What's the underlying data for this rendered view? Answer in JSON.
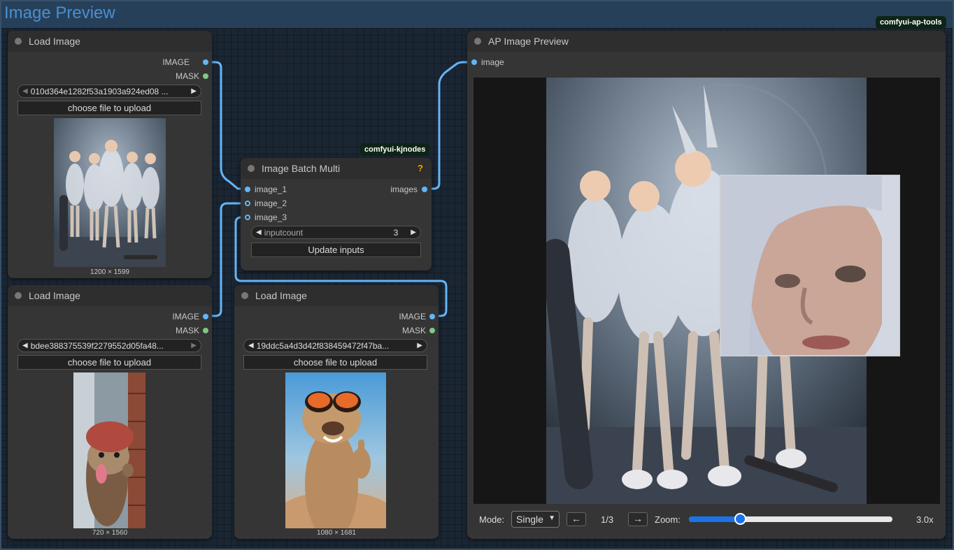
{
  "group": {
    "title": "Image Preview"
  },
  "badges": {
    "kjnodes": "comfyui-kjnodes",
    "ap_tools": "comfyui-ap-tools"
  },
  "load_image_1": {
    "title": "Load Image",
    "out_image": "IMAGE",
    "out_mask": "MASK",
    "file": "010d364e1282f53a1903a924ed08 ...",
    "upload_label": "choose file to upload",
    "dimensions": "1200 × 1599"
  },
  "load_image_2": {
    "title": "Load Image",
    "out_image": "IMAGE",
    "out_mask": "MASK",
    "file": "bdee388375539f2279552d05fa48...",
    "upload_label": "choose file to upload",
    "dimensions": "720 × 1560"
  },
  "load_image_3": {
    "title": "Load Image",
    "out_image": "IMAGE",
    "out_mask": "MASK",
    "file": "19ddc5a4d3d42f838459472f47ba...",
    "upload_label": "choose file to upload",
    "dimensions": "1080 × 1681"
  },
  "batch": {
    "title": "Image Batch Multi",
    "help": "?",
    "inputs": [
      "image_1",
      "image_2",
      "image_3"
    ],
    "output": "images",
    "inputcount_label": "inputcount",
    "inputcount_value": "3",
    "update_label": "Update inputs"
  },
  "preview": {
    "title": "AP Image Preview",
    "input": "image",
    "mode_label": "Mode:",
    "mode_value": "Single",
    "prev": "←",
    "next": "→",
    "page": "1/3",
    "zoom_label": "Zoom:",
    "zoom_value": "3.0x",
    "zoom_fraction": 0.25
  },
  "colors": {
    "image_slot": "#64b5f6",
    "mask_slot": "#81c784",
    "wire": "#64b5f6"
  }
}
